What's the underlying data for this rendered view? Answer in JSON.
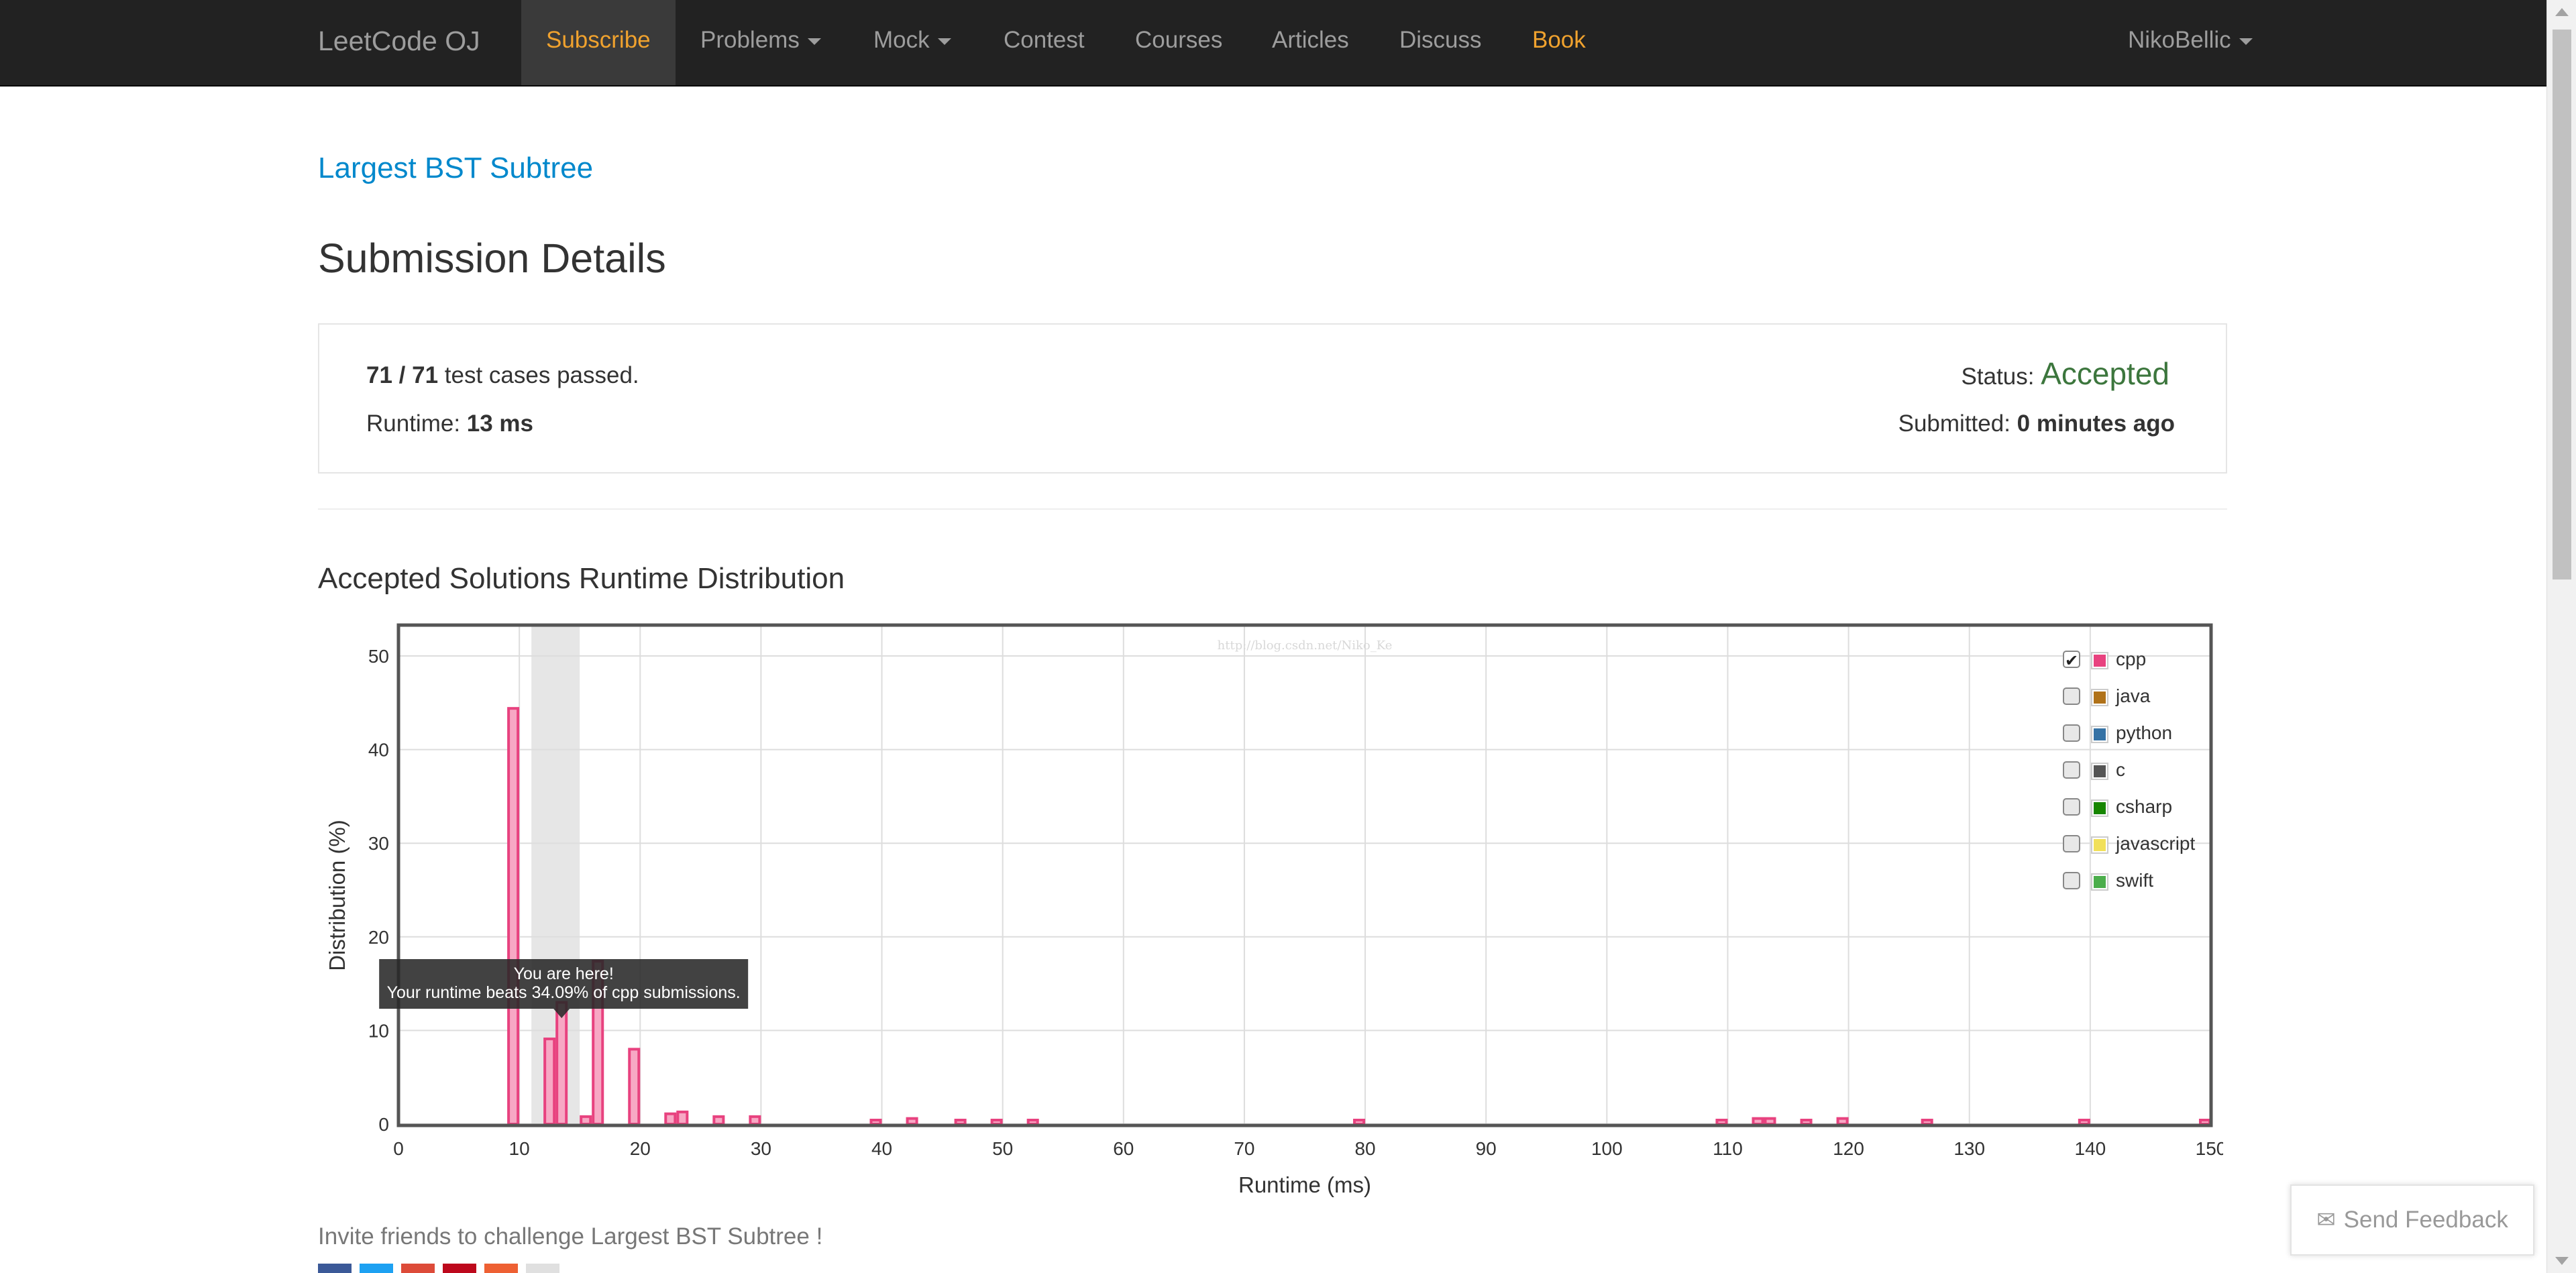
{
  "navbar": {
    "brand": "LeetCode OJ",
    "items": [
      {
        "label": "Subscribe",
        "dropdown": false
      },
      {
        "label": "Problems",
        "dropdown": true
      },
      {
        "label": "Mock",
        "dropdown": true
      },
      {
        "label": "Contest",
        "dropdown": false
      },
      {
        "label": "Courses",
        "dropdown": false
      },
      {
        "label": "Articles",
        "dropdown": false
      },
      {
        "label": "Discuss",
        "dropdown": false
      },
      {
        "label": "Book",
        "dropdown": false
      }
    ],
    "user": "NikoBellic"
  },
  "problem_title": "Largest BST Subtree",
  "page_title": "Submission Details",
  "details": {
    "passed": "71 / 71",
    "passed_suffix": " test cases passed.",
    "runtime_label": "Runtime: ",
    "runtime_value": "13 ms",
    "status_label": "Status: ",
    "status_value": "Accepted",
    "submitted_label": "Submitted: ",
    "submitted_value": "0 minutes ago"
  },
  "section_title": "Accepted Solutions Runtime Distribution",
  "chart_data": {
    "type": "bar",
    "xlabel": "Runtime (ms)",
    "ylabel": "Distribution (%)",
    "xlim": [
      0,
      150
    ],
    "ylim": [
      0,
      50
    ],
    "xticks": [
      0,
      10,
      20,
      30,
      40,
      50,
      60,
      70,
      80,
      90,
      100,
      110,
      120,
      130,
      140,
      150
    ],
    "yticks": [
      0,
      10,
      20,
      30,
      40,
      50
    ],
    "grid": true,
    "watermark": "http://blog.csdn.net/Niko_Ke",
    "highlight_range": [
      11,
      15
    ],
    "bars": [
      {
        "x": 9.5,
        "y": 44.4
      },
      {
        "x": 12.5,
        "y": 9.1
      },
      {
        "x": 13.5,
        "y": 13.0
      },
      {
        "x": 15.5,
        "y": 0.8
      },
      {
        "x": 16.5,
        "y": 17.4
      },
      {
        "x": 19.5,
        "y": 8.0
      },
      {
        "x": 22.5,
        "y": 1.1
      },
      {
        "x": 23.5,
        "y": 1.3
      },
      {
        "x": 26.5,
        "y": 0.8
      },
      {
        "x": 29.5,
        "y": 0.8
      },
      {
        "x": 39.5,
        "y": 0.4
      },
      {
        "x": 42.5,
        "y": 0.6
      },
      {
        "x": 46.5,
        "y": 0.3
      },
      {
        "x": 49.5,
        "y": 0.3
      },
      {
        "x": 52.5,
        "y": 0.3
      },
      {
        "x": 79.5,
        "y": 0.3
      },
      {
        "x": 109.5,
        "y": 0.3
      },
      {
        "x": 112.5,
        "y": 0.6
      },
      {
        "x": 113.5,
        "y": 0.6
      },
      {
        "x": 116.5,
        "y": 0.3
      },
      {
        "x": 119.5,
        "y": 0.6
      },
      {
        "x": 126.5,
        "y": 0.3
      },
      {
        "x": 139.5,
        "y": 0.3
      },
      {
        "x": 149.5,
        "y": 0.3
      }
    ],
    "legend": [
      {
        "name": "cpp",
        "color": "#e8427f",
        "checked": true
      },
      {
        "name": "java",
        "color": "#b07219",
        "checked": false
      },
      {
        "name": "python",
        "color": "#3572a5",
        "checked": false
      },
      {
        "name": "c",
        "color": "#555555",
        "checked": false
      },
      {
        "name": "csharp",
        "color": "#178600",
        "checked": false
      },
      {
        "name": "javascript",
        "color": "#f1e05a",
        "checked": false
      },
      {
        "name": "swift",
        "color": "#4cae4c",
        "checked": false
      }
    ],
    "legend_position": "top-right",
    "tooltip": {
      "line1": "You are here!",
      "line2": "Your runtime beats 34.09% of cpp submissions.",
      "x": 13.5
    }
  },
  "invite_text": "Invite friends to challenge Largest BST Subtree !",
  "feedback_label": "Send Feedback",
  "share_colors": [
    "#3b5998",
    "#1da1f2",
    "#dd4b39",
    "#bd081c",
    "#ee6033",
    "#e0e0e0"
  ],
  "colors": {
    "navbar_bg": "#222222",
    "link": "#0088cc",
    "accepted": "#3c763d",
    "orange": "#f0a22e",
    "bar_fill": "#f7a8c4",
    "bar_stroke": "#e8427f"
  }
}
